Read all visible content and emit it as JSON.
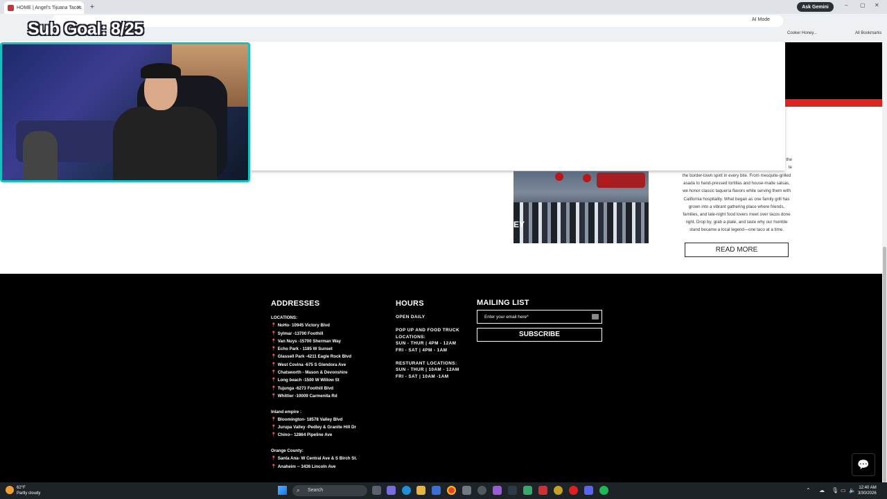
{
  "browser": {
    "tab_title": "HOME | Angel's Tijuana Tacos",
    "tab_close": "×",
    "new_tab": "+",
    "ask_gemini": "Ask Gemini",
    "ai_mode": "AI Mode",
    "bookmark_crock": "Cooker Honey...",
    "bookmark_all": "All Bookmarks",
    "win_min": "–",
    "win_max": "▢",
    "win_close": "✕"
  },
  "overlay": {
    "sub_goal": "Sub Goal: 8/25"
  },
  "about": {
    "story_partial": "the\nte\nthe border-town spirit in every bite. From mesquite-grilled asada to hand-pressed tortillas and house-made salsas, we honor classic taquería flavors while serving them with California hospitality. What began as one family grill has grown into a vibrant gathering place where friends, families, and late-night food lovers meet over tacos done right. Drop by, grab a plate, and taste why our humble stand became a local legend—one taco at a time.",
    "story_visible": "the border-town spirit in every bite. From mesquite-grilled asada to hand-pressed tortillas and house-made salsas, we honor classic taquería flavors while serving them with California hospitality. What began as one family grill has grown into a vibrant gathering place where friends, families, and late-night food lovers meet over tacos done right. Drop by, grab a plate, and taste why our humble stand became a local legend—one taco at a time.",
    "read_more": "READ MORE",
    "photo_sign": "EY"
  },
  "footer": {
    "addresses": {
      "heading": "ADDRESSES",
      "locations_label": "LOCATIONS:",
      "locations": [
        "NoHo- 10945 Victory Blvd",
        "Sylmar -13700 Foothill",
        "Van Nuys -15700 Sherman Way",
        "Echo Park - 1185 W Sunset",
        "Glassell Park -4211 Eagle Rock Blvd",
        "West Covina -675 S Glendora Ave",
        "Chatsworth - Mason & Devonshire",
        "Long beach -1500 W Willow St",
        "Tujunga -6273 Foothill Blvd",
        "Whittier -10009 Carmenita Rd"
      ],
      "inland_label": "Inland empire :",
      "inland": [
        "Bloomington- 18578 Valley Blvd",
        "Jurupa Valley -Pedley & Granite Hill Dr",
        "Chino-- 12864 Pipeline Ave"
      ],
      "orange_label": "Orange County:",
      "orange": [
        "Santa Ana- W Central Ave & S Birch St.",
        "Anaheim -- 3436 Lincoln Ave"
      ]
    },
    "hours": {
      "heading": "HOURS",
      "open_daily": "OPEN DAILY",
      "popup_label": "POP UP AND FOOD TRUCK LOCATIONS:",
      "popup_1": "SUN - THUR | 4PM - 12AM",
      "popup_2": "FRI - SAT | 4PM - 1AM",
      "rest_label": "RESTURANT LOCATIONS:",
      "rest_1": "SUN - THUR | 10AM - 12AM",
      "rest_2": "FRI - SAT | 10AM -1AM"
    },
    "mailing": {
      "heading": "MAILING LIST",
      "placeholder": "Enter your email here*",
      "subscribe": "SUBSCRIBE"
    }
  },
  "taskbar": {
    "temp": "62°F",
    "weather": "Partly cloudy",
    "search": "Search",
    "time": "12:40 AM",
    "date": "3/30/2026"
  },
  "colors": {
    "accent_red": "#d22222",
    "footer_bg": "#000000",
    "webcam_border": "#17c0c0"
  }
}
